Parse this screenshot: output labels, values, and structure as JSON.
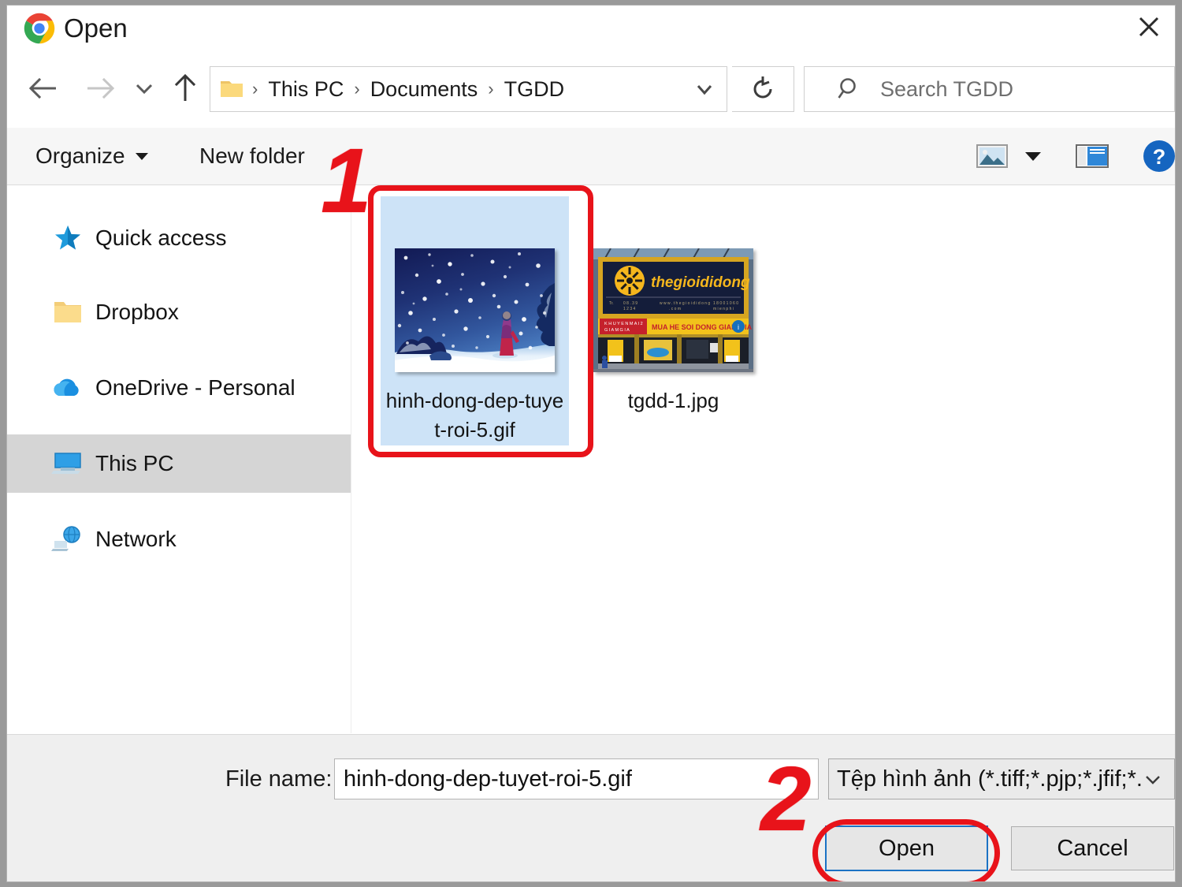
{
  "window": {
    "title": "Open",
    "app_icon": "chrome-icon",
    "close_label": "✕"
  },
  "nav": {
    "back": "back-arrow-icon",
    "forward": "forward-arrow-icon",
    "recent": "recent-locations-chevron-icon",
    "up": "up-arrow-icon",
    "refresh": "refresh-icon"
  },
  "address": {
    "folder_icon": "folder-icon",
    "separator": "›",
    "crumbs": [
      "This PC",
      "Documents",
      "TGDD"
    ],
    "dropdown_icon": "chevron-down-icon"
  },
  "search": {
    "icon": "search-icon",
    "placeholder": "Search TGDD"
  },
  "toolbar": {
    "organize_label": "Organize",
    "new_folder_label": "New folder",
    "view_icon": "picture-view-icon",
    "view_caret_icon": "caret-down-icon",
    "preview_pane_icon": "preview-pane-icon",
    "help_icon": "help-question-icon"
  },
  "sidebar": {
    "items": [
      {
        "label": "Quick access",
        "icon": "star-icon",
        "selected": false
      },
      {
        "label": "Dropbox",
        "icon": "folder-icon",
        "selected": false
      },
      {
        "label": "OneDrive - Personal",
        "icon": "cloud-icon",
        "selected": false
      },
      {
        "label": "This PC",
        "icon": "monitor-icon",
        "selected": true
      },
      {
        "label": "Network",
        "icon": "network-icon",
        "selected": false
      }
    ]
  },
  "files": [
    {
      "name": "hinh-dong-dep-tuyet-roi-5.gif",
      "thumb": "snow-night-scene",
      "selected": true
    },
    {
      "name": "tgdd-1.jpg",
      "thumb": "thegioididong-storefront",
      "selected": false
    }
  ],
  "footer": {
    "filename_label": "File name:",
    "filename_value": "hinh-dong-dep-tuyet-roi-5.gif",
    "filetype_value": "Tệp hình ảnh (*.tiff;*.pjp;*.jfif;*.g",
    "filetype_caret_icon": "chevron-down-icon",
    "open_label": "Open",
    "cancel_label": "Cancel"
  },
  "annotations": {
    "step_one": "1",
    "step_two": "2",
    "color": "#E8131A"
  },
  "colors": {
    "selection_blue": "#CDE3F7",
    "sidebar_selected_gray": "#D5D5D5",
    "focus_blue": "#1B72C4",
    "annotation_red": "#E8131A",
    "toolbar_gray": "#F6F6F6",
    "footer_gray": "#EFEFEF"
  }
}
